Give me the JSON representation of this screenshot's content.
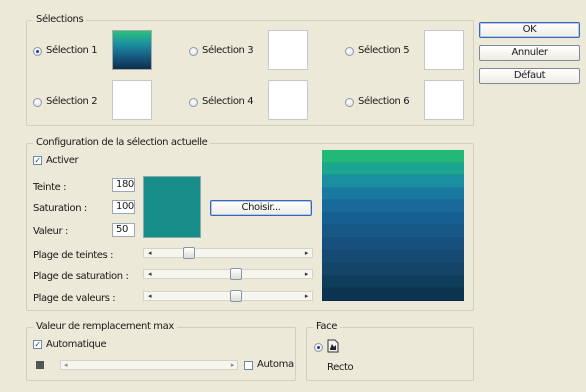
{
  "buttons": {
    "ok": "OK",
    "cancel": "Annuler",
    "defaults": "Défaut"
  },
  "selections": {
    "title": "Sélections",
    "items": [
      {
        "label": "Sélection 1",
        "selected": true
      },
      {
        "label": "Sélection 2",
        "selected": false
      },
      {
        "label": "Sélection 3",
        "selected": false
      },
      {
        "label": "Sélection 4",
        "selected": false
      },
      {
        "label": "Sélection 5",
        "selected": false
      },
      {
        "label": "Sélection 6",
        "selected": false
      }
    ]
  },
  "config": {
    "title": "Configuration de la sélection actuelle",
    "enable_label": "Activer",
    "enable_checked": true,
    "hue_label": "Teinte :",
    "hue_value": "180",
    "saturation_label": "Saturation :",
    "saturation_value": "100",
    "value_label": "Valeur :",
    "value_value": "50",
    "swatch_color": "#168d88",
    "choose_button": "Choisir...",
    "sliders": [
      {
        "label": "Plage de teintes :",
        "position": 0.2
      },
      {
        "label": "Plage de saturation :",
        "position": 0.55
      },
      {
        "label": "Plage de valeurs :",
        "position": 0.55
      }
    ],
    "ramp_colors": [
      "#22b878",
      "#1aa690",
      "#1a8fa2",
      "#1a79a0",
      "#19699a",
      "#175f90",
      "#185886",
      "#17507c",
      "#164a72",
      "#124568",
      "#0f3e5c",
      "#0c3450"
    ]
  },
  "max_replacement": {
    "title": "Valeur de remplacement max",
    "auto_label": "Automatique",
    "auto_checked": true,
    "automa_label": "Automa"
  },
  "face": {
    "title": "Face",
    "option_label": "Recto"
  }
}
